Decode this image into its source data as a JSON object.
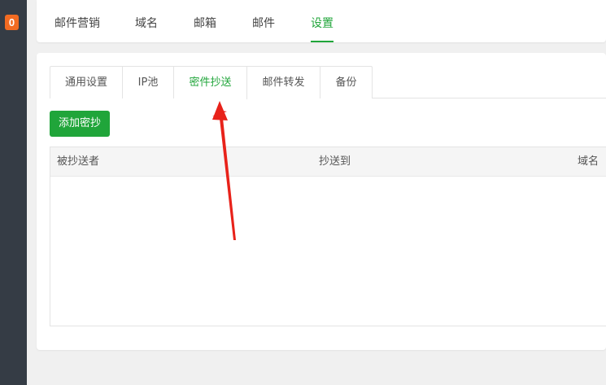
{
  "sidebar": {
    "badge": "0"
  },
  "top_tabs": [
    {
      "label": "邮件营销"
    },
    {
      "label": "域名"
    },
    {
      "label": "邮箱"
    },
    {
      "label": "邮件"
    },
    {
      "label": "设置"
    }
  ],
  "top_tabs_active": "设置",
  "sub_tabs": [
    {
      "label": "通用设置"
    },
    {
      "label": "IP池"
    },
    {
      "label": "密件抄送"
    },
    {
      "label": "邮件转发"
    },
    {
      "label": "备份"
    }
  ],
  "sub_tabs_active": "密件抄送",
  "toolbar": {
    "add_label": "添加密抄"
  },
  "table": {
    "columns": [
      "被抄送者",
      "抄送到",
      "域名"
    ],
    "rows": []
  },
  "colors": {
    "accent": "#20a53a",
    "sidebar": "#353c45",
    "badge": "#f26b22",
    "annotation_arrow": "#e8221a"
  },
  "annotation": {
    "type": "red-arrow",
    "points_to": "密件抄送"
  }
}
